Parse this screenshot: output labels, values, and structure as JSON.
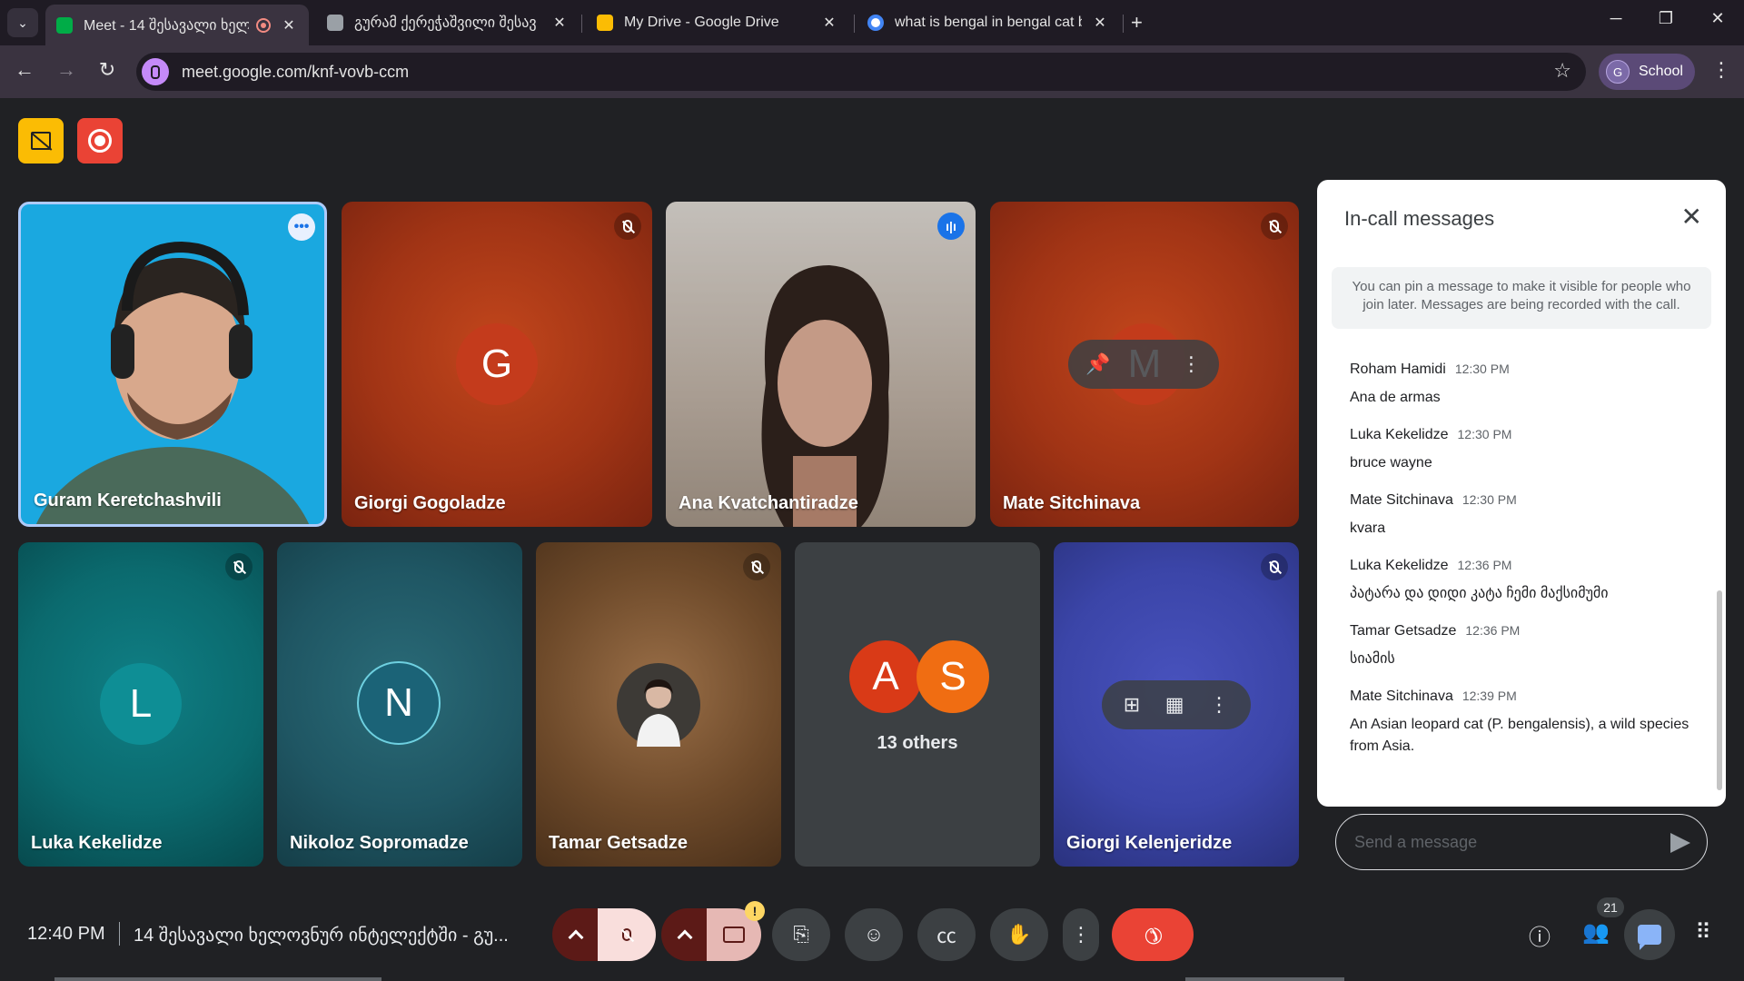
{
  "browser": {
    "tabs": [
      {
        "title": "Meet - 14 შესავალი ხელ",
        "favicon_color": "#00ac47",
        "recording": true
      },
      {
        "title": "გურამ ქერეჭაშვილი შესავ",
        "favicon_color": "#9aa0a6"
      },
      {
        "title": "My Drive - Google Drive",
        "favicon_color": "#fbbc04"
      },
      {
        "title": "what is bengal in bengal cat bri",
        "favicon_color": "#4285f4"
      }
    ],
    "url": "meet.google.com/knf-vovb-ccm",
    "profile_label": "School",
    "profile_initial": "G"
  },
  "meet": {
    "tiles": [
      {
        "name": "Guram Keretchashvili",
        "bg": "#1aa8e0"
      },
      {
        "name": "Giorgi Gogoladze",
        "initial": "G",
        "bg": "#b33a16",
        "avatar": "#c43b1c"
      },
      {
        "name": "Ana Kvatchantiradze",
        "bg": "#9b8e84"
      },
      {
        "name": "Mate Sitchinava",
        "initial": "M",
        "bg": "#b33a16",
        "avatar": "#c43b1c"
      },
      {
        "name": "Luka Kekelidze",
        "initial": "L",
        "bg": "#0b6f73",
        "avatar": "#0e8e95"
      },
      {
        "name": "Nikoloz Sopromadze",
        "initial": "N",
        "bg": "#1f5c6a",
        "avatar": "#1b6377"
      },
      {
        "name": "Tamar Getsadze",
        "bg": "#6e4a2a"
      },
      {
        "others_label": "13 others",
        "initials": [
          "A",
          "S"
        ],
        "colors": [
          "#d93a17",
          "#f06d12"
        ]
      },
      {
        "name": "Giorgi Kelenjeridze",
        "bg": "#3b45a8"
      }
    ],
    "chat": {
      "title": "In-call messages",
      "note": "You can pin a message to make it visible for people who join later. Messages are being recorded with the call.",
      "messages": [
        {
          "sender": "Roham Hamidi",
          "time": "12:30 PM",
          "text": "Ana de armas"
        },
        {
          "sender": "Luka Kekelidze",
          "time": "12:30 PM",
          "text": "bruce wayne"
        },
        {
          "sender": "Mate Sitchinava",
          "time": "12:30 PM",
          "text": "kvara"
        },
        {
          "sender": "Luka Kekelidze",
          "time": "12:36 PM",
          "text": "პატარა და დიდი კატა ჩემი მაქსიმუმი"
        },
        {
          "sender": "Tamar Getsadze",
          "time": "12:36 PM",
          "text": "სიამის"
        },
        {
          "sender": "Mate Sitchinava",
          "time": "12:39 PM",
          "text": "An Asian leopard cat (P. bengalensis), a wild species from Asia."
        }
      ],
      "input_placeholder": "Send a message"
    },
    "bottom": {
      "time": "12:40 PM",
      "meeting_title": "14 შესავალი ხელოვნურ ინტელექტში - გუ...",
      "participants_count": "21"
    }
  }
}
